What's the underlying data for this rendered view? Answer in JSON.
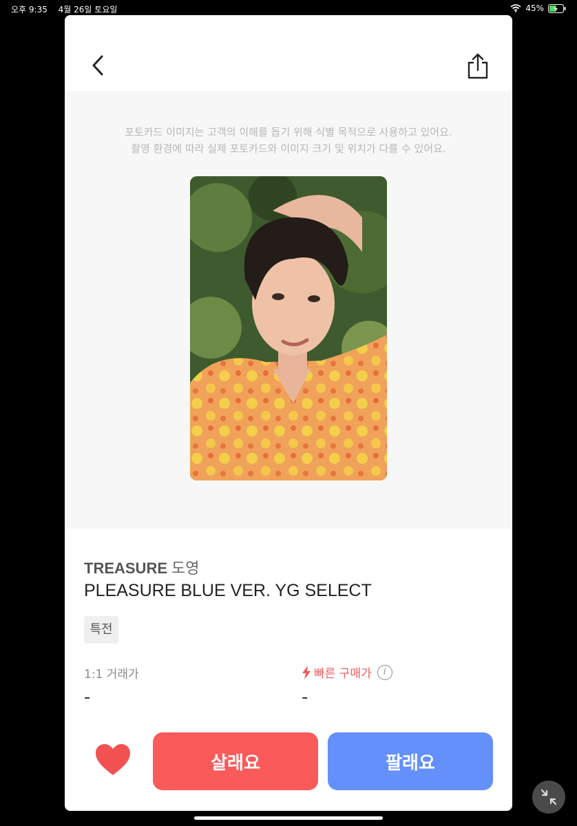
{
  "status_bar": {
    "time": "오후 9:35",
    "date": "4월 26일 토요일",
    "battery": "45%"
  },
  "nav": {
    "back_icon": "chevron-left-icon",
    "share_icon": "share-icon"
  },
  "notice": {
    "line1": "포토카드 이미지는 고객의 이해를 돕기 위해 식별 목적으로 사용하고 있어요.",
    "line2": "촬영 환경에 따라 실제 포토카드와 이미지 크기 및 위치가 다를 수 있어요."
  },
  "product": {
    "group": "TREASURE",
    "member": "도영",
    "title": "PLEASURE BLUE VER. YG SELECT",
    "tag": "특전"
  },
  "prices": {
    "left_label": "1:1 거래가",
    "left_value": "-",
    "right_label": "빠른 구매가",
    "right_value": "-",
    "info_glyph": "i"
  },
  "actions": {
    "buy_label": "살래요",
    "sell_label": "팔래요"
  },
  "colors": {
    "buy": "#fb5a5a",
    "sell": "#6490fb",
    "heart": "#f25252",
    "fast": "#f1595b"
  }
}
